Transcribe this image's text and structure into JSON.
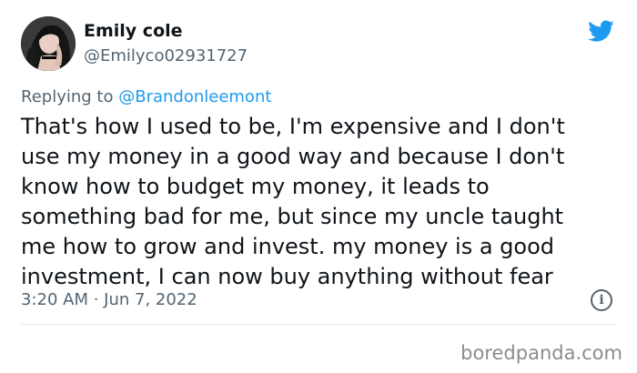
{
  "tweet": {
    "display_name": "Emily cole",
    "handle": "@Emilyco02931727",
    "replying_prefix": "Replying to",
    "replying_to": "@Brandonleemont",
    "text_lines": [
      "That's how I used to be, I'm expensive and I don't",
      "use my money in a good way and because I don't",
      "know how to budget my money, it leads to",
      "something bad for me, but since my uncle taught",
      "me how to grow and invest. my money is a good",
      "investment, I can now buy anything without fear"
    ],
    "timestamp": "3:20 AM · Jun 7, 2022",
    "info_icon_glyph": "i"
  },
  "watermark": "boredpanda.com",
  "icons": {
    "brand": "twitter-bird-icon",
    "info": "info-icon"
  },
  "colors": {
    "brand_blue": "#1d9bf0",
    "secondary_text": "#536471",
    "primary_text": "#0f1419",
    "divider": "#e6ecf0",
    "watermark": "#8c8c8c"
  }
}
